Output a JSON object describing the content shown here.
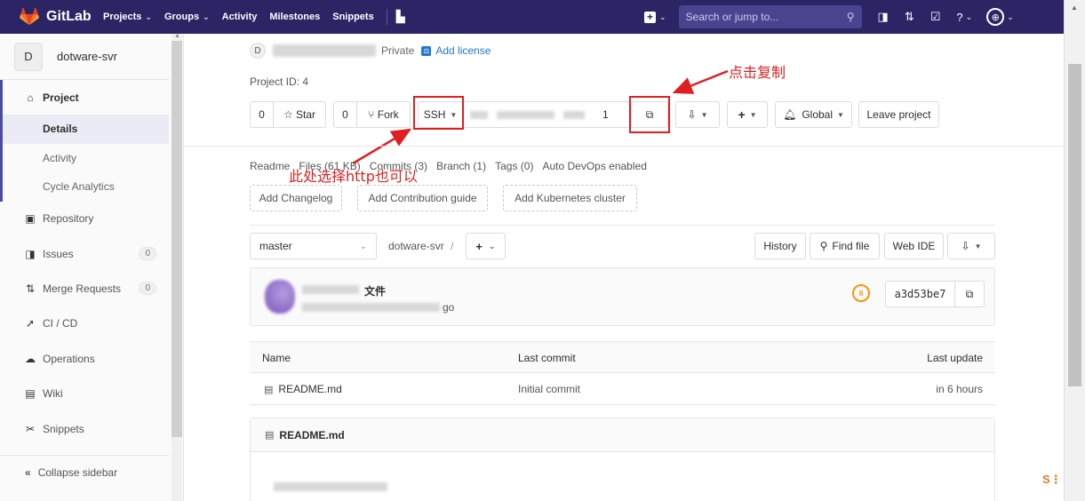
{
  "navbar": {
    "brand": "GitLab",
    "items": [
      {
        "label": "Projects",
        "chevron": true
      },
      {
        "label": "Groups",
        "chevron": true
      },
      {
        "label": "Activity",
        "chevron": false
      },
      {
        "label": "Milestones",
        "chevron": false
      },
      {
        "label": "Snippets",
        "chevron": false
      }
    ],
    "search_placeholder": "Search or jump to...",
    "brand_color": "#2b2566"
  },
  "sidebar": {
    "project_initial": "D",
    "project_name": "dotware-svr",
    "project_header": "Project",
    "project_subitems": [
      "Details",
      "Activity",
      "Cycle Analytics"
    ],
    "items": [
      {
        "label": "Repository",
        "icon": "repository-icon"
      },
      {
        "label": "Issues",
        "icon": "issues-icon",
        "count": "0"
      },
      {
        "label": "Merge Requests",
        "icon": "merge-request-icon",
        "count": "0"
      },
      {
        "label": "CI / CD",
        "icon": "rocket-icon"
      },
      {
        "label": "Operations",
        "icon": "operations-icon"
      },
      {
        "label": "Wiki",
        "icon": "wiki-icon"
      },
      {
        "label": "Snippets",
        "icon": "scissors-icon"
      }
    ],
    "collapse_label": "Collapse sidebar"
  },
  "project": {
    "avatar_initial": "D",
    "visibility": "Private",
    "add_license": "Add license",
    "project_id": "Project ID: 4",
    "star_count": "0",
    "star_label": "Star",
    "fork_count": "0",
    "fork_label": "Fork",
    "clone_protocol": "SSH",
    "clone_url_tail": "1",
    "notification_label": "Global",
    "leave_label": "Leave project"
  },
  "annotations": {
    "copy": "点击复制",
    "http": "此处选择http也可以"
  },
  "stats": {
    "readme": "Readme",
    "files": "Files (61 KB)",
    "commits": "Commits (3)",
    "branch": "Branch (1)",
    "tags": "Tags (0)",
    "devops": "Auto DevOps enabled"
  },
  "quick_actions": [
    "Add Changelog",
    "Add Contribution guide",
    "Add Kubernetes cluster"
  ],
  "repo": {
    "branch": "master",
    "path": "dotware-svr",
    "sep": "/",
    "history": "History",
    "find_file": "Find file",
    "web_ide": "Web IDE"
  },
  "commit": {
    "title_tail": "文件",
    "sub_tail": "go",
    "sha": "a3d53be7"
  },
  "table": {
    "headers": [
      "Name",
      "Last commit",
      "Last update"
    ],
    "rows": [
      {
        "name": "README.md",
        "commit": "Initial commit",
        "update": "in 6 hours"
      }
    ]
  },
  "readme": {
    "title": "README.md"
  }
}
